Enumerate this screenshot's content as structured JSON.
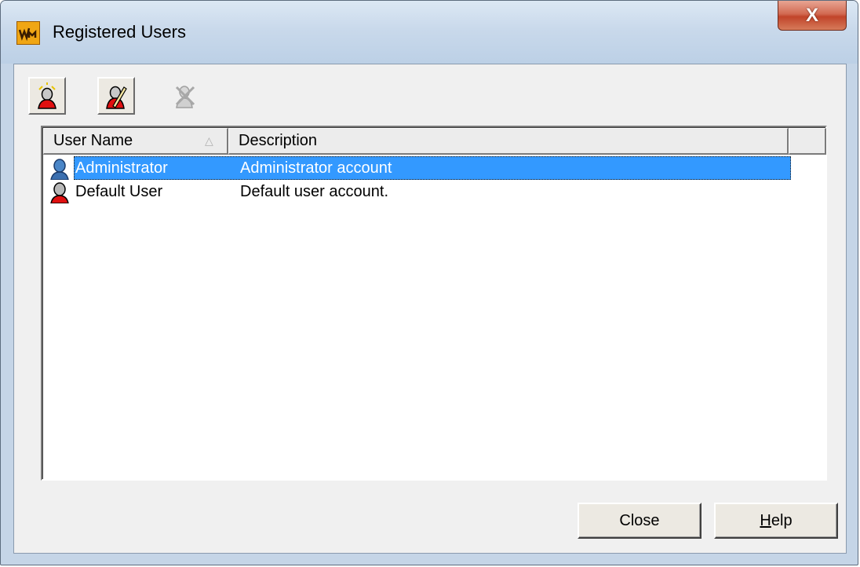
{
  "window": {
    "title": "Registered Users",
    "close_glyph": "X",
    "app_icon": "app-logo-icon"
  },
  "toolbar": {
    "buttons": [
      {
        "name": "add-user",
        "icon": "add-user-icon",
        "enabled": true
      },
      {
        "name": "edit-user",
        "icon": "edit-user-icon",
        "enabled": true
      },
      {
        "name": "delete-user",
        "icon": "delete-user-icon",
        "enabled": false
      }
    ]
  },
  "list": {
    "columns": [
      "User Name",
      "Description"
    ],
    "sort_indicator": "△",
    "rows": [
      {
        "name": "Administrator",
        "description": "Administrator account",
        "icon": "admin-user-icon",
        "selected": true
      },
      {
        "name": "Default User",
        "description": "Default user account.",
        "icon": "default-user-icon",
        "selected": false
      }
    ]
  },
  "buttons": {
    "close_label": "Close",
    "help_label_prefix": "",
    "help_label_underlined": "H",
    "help_label_rest": "elp"
  },
  "colors": {
    "selection": "#3399ff",
    "close_button": "#c1442a",
    "app_icon": "#f0a614"
  }
}
